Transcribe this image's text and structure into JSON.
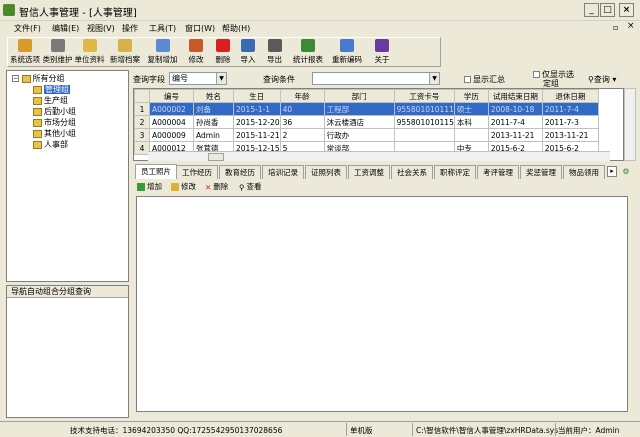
{
  "window": {
    "title": "智信人事管理 - [人事管理]",
    "min": "_",
    "max": "□",
    "close": "×",
    "inner_restore": "ð",
    "inner_close": "×"
  },
  "menu": [
    "文件(F)",
    "编辑(E)",
    "视图(V)",
    "操作",
    "工具(T)",
    "窗口(W)",
    "帮助(H)"
  ],
  "toolbar": [
    {
      "label": "系统选项",
      "color": "#d89a2a"
    },
    {
      "label": "类别维护",
      "color": "#7a7a7a"
    },
    {
      "label": "单位资料",
      "color": "#e0b84a"
    },
    {
      "label": "新增档案",
      "color": "#d8b04a"
    },
    {
      "label": "复制增加",
      "color": "#5a8ad0"
    },
    {
      "label": "修改",
      "color": "#c85a2a"
    },
    {
      "label": "删除",
      "color": "#d82020"
    },
    {
      "label": "导入",
      "color": "#3a6ab0"
    },
    {
      "label": "导出",
      "color": "#5a5a5a"
    },
    {
      "label": "统计报表",
      "color": "#3a8a3a"
    },
    {
      "label": "重新编码",
      "color": "#4a7ad0"
    },
    {
      "label": "关于",
      "color": "#6a3aa0"
    }
  ],
  "tree": {
    "root": "所有分组",
    "items": [
      "管理组",
      "生产组",
      "后勤小组",
      "市场分组",
      "其他小组",
      "人事部"
    ],
    "selected_index": 0
  },
  "nav_panel": {
    "title": "导航自动组合分组查询"
  },
  "query": {
    "field_label": "查询字段",
    "field_value": "编号",
    "condition_label": "查询条件",
    "condition_value": "",
    "show_summary": "显示汇总",
    "show_hired_1": "仅显示选",
    "show_hired_2": "定组",
    "search": "查询"
  },
  "grid": {
    "columns": [
      "编号",
      "姓名",
      "生日",
      "年龄",
      "部门",
      "工资卡号",
      "学历",
      "试用结束日期",
      "退休日期"
    ],
    "rows": [
      {
        "n": "1",
        "cells": [
          "A000002",
          "刘备",
          "2015-1-1",
          "40",
          "工程部",
          "955801010111",
          "硕士",
          "2008-10-18",
          "2011-7-4"
        ]
      },
      {
        "n": "2",
        "cells": [
          "A000004",
          "孙尚香",
          "2015-12-20",
          "36",
          "沐云楼酒店",
          "955801010115",
          "本科",
          "2011-7-4",
          "2011-7-3"
        ]
      },
      {
        "n": "3",
        "cells": [
          "A000009",
          "Admin",
          "2015-11-21",
          "2",
          "行政办",
          "",
          "",
          "2013-11-21",
          "2013-11-21"
        ]
      },
      {
        "n": "4",
        "cells": [
          "A000012",
          "张茸德",
          "2015-12-15",
          "5",
          "常谈部",
          "",
          "中专",
          "2015-6-2",
          "2015-6-2"
        ]
      }
    ]
  },
  "tabs": [
    "员工照片",
    "工作经历",
    "教育经历",
    "培训记录",
    "证照列表",
    "工资调整",
    "社会关系",
    "职称评定",
    "考评管理",
    "奖惩管理",
    "物品领用"
  ],
  "subbar": {
    "add": "增加",
    "edit": "修改",
    "delete": "删除",
    "view": "查看"
  },
  "status": {
    "support": "技术支持电话：13694203350 QQ:1725542950137028656",
    "mode": "单机版",
    "path": "C:\\智信软件\\智信人事管理\\zxHRData.sys",
    "user": "当前用户：Admin"
  }
}
